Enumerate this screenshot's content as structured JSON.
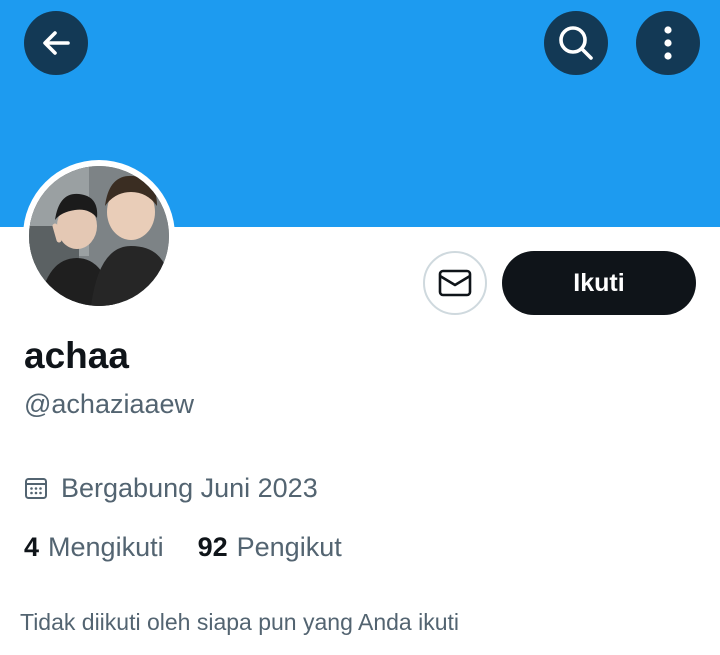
{
  "header": {
    "back_icon": "arrow-left-icon",
    "search_icon": "search-icon",
    "more_icon": "more-vertical-icon",
    "banner_color": "#1d9bf0"
  },
  "profile": {
    "avatar_alt": "Foto profil",
    "display_name": "achaa",
    "handle": "@achaziaaew",
    "joined_label": "Bergabung Juni 2023",
    "joined_icon": "calendar-icon"
  },
  "actions": {
    "message_icon": "mail-icon",
    "follow_label": "Ikuti"
  },
  "stats": {
    "following_count": "4",
    "following_label": "Mengikuti",
    "followers_count": "92",
    "followers_label": "Pengikut"
  },
  "footer_note": "Tidak diikuti oleh siapa pun yang Anda ikuti"
}
